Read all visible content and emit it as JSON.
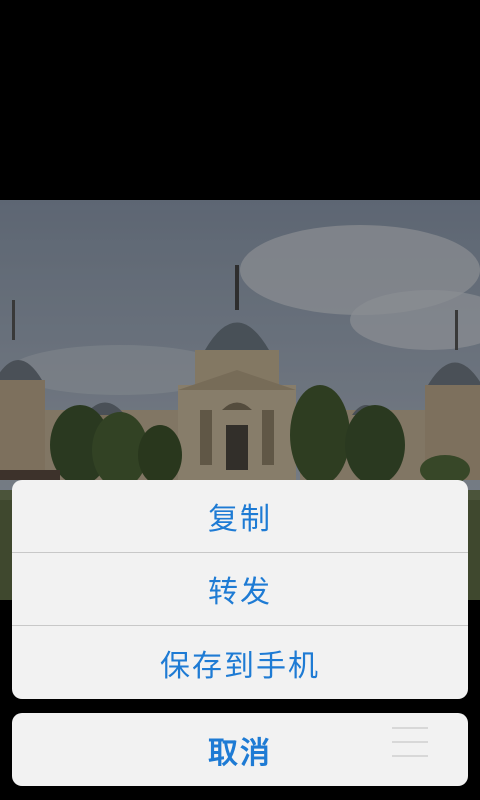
{
  "photo": {
    "subject": "building-photo"
  },
  "action_sheet": {
    "items": [
      {
        "label": "复制"
      },
      {
        "label": "转发"
      },
      {
        "label": "保存到手机"
      }
    ],
    "cancel_label": "取消"
  },
  "colors": {
    "accent": "#1e7bd4",
    "sheet_bg": "#f2f2f2",
    "divider": "#c8c8c8",
    "background": "#000000"
  }
}
